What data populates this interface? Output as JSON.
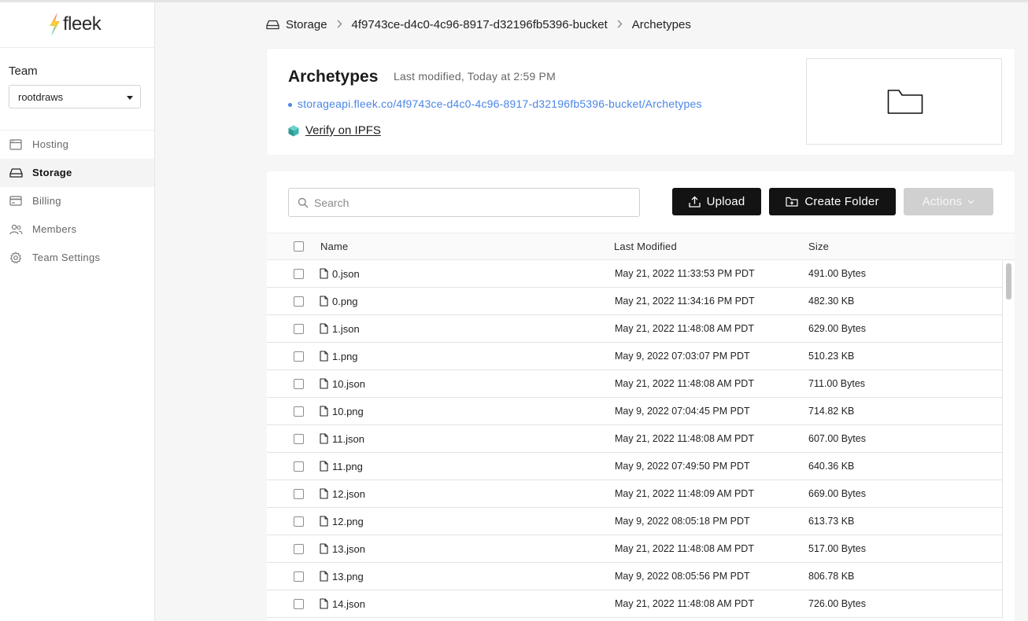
{
  "brand": {
    "name": "fleek"
  },
  "sidebar": {
    "team_label": "Team",
    "team_selected": "rootdraws",
    "items": [
      {
        "label": "Hosting",
        "icon": "browser-window-icon"
      },
      {
        "label": "Storage",
        "icon": "hard-drive-icon"
      },
      {
        "label": "Billing",
        "icon": "credit-card-icon"
      },
      {
        "label": "Members",
        "icon": "users-icon"
      },
      {
        "label": "Team Settings",
        "icon": "gear-icon"
      }
    ],
    "active": "Storage"
  },
  "breadcrumb": [
    "Storage",
    "4f9743ce-d4c0-4c96-8917-d32196fb5396-bucket",
    "Archetypes"
  ],
  "folder": {
    "title": "Archetypes",
    "modified": "Last modified, Today at 2:59 PM",
    "url": "storageapi.fleek.co/4f9743ce-d4c0-4c96-8917-d32196fb5396-bucket/Archetypes",
    "verify_label": "Verify on IPFS"
  },
  "toolbar": {
    "search_placeholder": "Search",
    "upload_label": "Upload",
    "create_folder_label": "Create Folder",
    "actions_label": "Actions"
  },
  "table": {
    "headers": {
      "name": "Name",
      "modified": "Last Modified",
      "size": "Size"
    },
    "rows": [
      {
        "name": "0.json",
        "modified": "May 21, 2022 11:33:53 PM PDT",
        "size": "491.00 Bytes"
      },
      {
        "name": "0.png",
        "modified": "May 21, 2022 11:34:16 PM PDT",
        "size": "482.30 KB"
      },
      {
        "name": "1.json",
        "modified": "May 21, 2022 11:48:08 AM PDT",
        "size": "629.00 Bytes"
      },
      {
        "name": "1.png",
        "modified": "May 9, 2022 07:03:07 PM PDT",
        "size": "510.23 KB"
      },
      {
        "name": "10.json",
        "modified": "May 21, 2022 11:48:08 AM PDT",
        "size": "711.00 Bytes"
      },
      {
        "name": "10.png",
        "modified": "May 9, 2022 07:04:45 PM PDT",
        "size": "714.82 KB"
      },
      {
        "name": "11.json",
        "modified": "May 21, 2022 11:48:08 AM PDT",
        "size": "607.00 Bytes"
      },
      {
        "name": "11.png",
        "modified": "May 9, 2022 07:49:50 PM PDT",
        "size": "640.36 KB"
      },
      {
        "name": "12.json",
        "modified": "May 21, 2022 11:48:09 AM PDT",
        "size": "669.00 Bytes"
      },
      {
        "name": "12.png",
        "modified": "May 9, 2022 08:05:18 PM PDT",
        "size": "613.73 KB"
      },
      {
        "name": "13.json",
        "modified": "May 21, 2022 11:48:08 AM PDT",
        "size": "517.00 Bytes"
      },
      {
        "name": "13.png",
        "modified": "May 9, 2022 08:05:56 PM PDT",
        "size": "806.78 KB"
      },
      {
        "name": "14.json",
        "modified": "May 21, 2022 11:48:08 AM PDT",
        "size": "726.00 Bytes"
      }
    ]
  },
  "colors": {
    "link": "#4a86e8",
    "primary_button": "#131313",
    "disabled_button": "#d0d0d0",
    "ipfs_cube": "#3fb5b0"
  }
}
